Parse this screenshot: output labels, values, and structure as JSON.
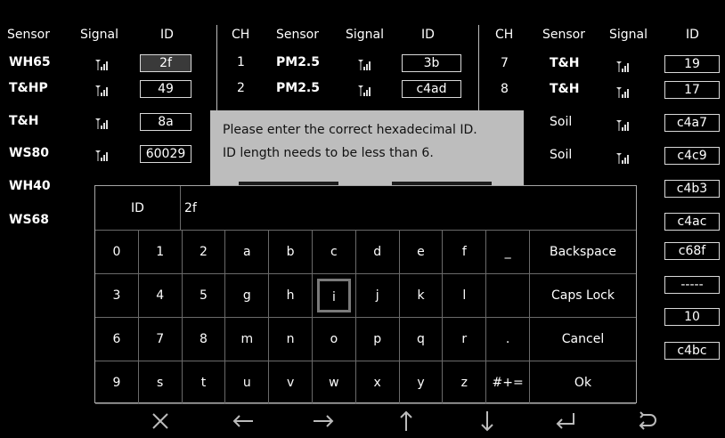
{
  "headers": {
    "col1": {
      "sensor": "Sensor",
      "signal": "Signal",
      "id": "ID"
    },
    "col2": {
      "ch": "CH",
      "sensor": "Sensor",
      "signal": "Signal",
      "id": "ID"
    },
    "col3": {
      "ch": "CH",
      "sensor": "Sensor",
      "signal": "Signal",
      "id": "ID"
    }
  },
  "table1": [
    {
      "sensor": "WH65",
      "id": "2f",
      "selected": true
    },
    {
      "sensor": "T&HP",
      "id": "49"
    },
    {
      "sensor": "T&H",
      "id": "8a"
    },
    {
      "sensor": "WS80",
      "id": "60029"
    },
    {
      "sensor": "WH40",
      "id": ""
    },
    {
      "sensor": "WS68",
      "id": ""
    }
  ],
  "table2": [
    {
      "ch": "1",
      "sensor": "PM2.5",
      "id": "3b"
    },
    {
      "ch": "2",
      "sensor": "PM2.5",
      "id": "c4ad"
    }
  ],
  "table3": [
    {
      "ch": "7",
      "sensor": "T&H",
      "id": "19"
    },
    {
      "ch": "8",
      "sensor": "T&H",
      "id": "17"
    },
    {
      "ch": "",
      "sensor": "Soil",
      "id": "c4a7"
    },
    {
      "ch": "",
      "sensor": "Soil",
      "id": "c4c9"
    },
    {
      "ch": "",
      "sensor": "",
      "id": "c4b3"
    },
    {
      "ch": "",
      "sensor": "",
      "id": "c4ac"
    },
    {
      "ch": "",
      "sensor": "",
      "id": "c68f"
    },
    {
      "ch": "",
      "sensor": "",
      "id": "-----"
    },
    {
      "ch": "",
      "sensor": "",
      "id": "10"
    },
    {
      "ch": "",
      "sensor": "",
      "id": "c4bc"
    }
  ],
  "dialog": {
    "line1": "Please enter the correct hexadecimal ID.",
    "line2": "ID length needs to be less than 6."
  },
  "keyboard": {
    "id_label": "ID",
    "input_value": "2f",
    "rows": [
      [
        "0",
        "1",
        "2",
        "a",
        "b",
        "c",
        "d",
        "e",
        "f",
        "_"
      ],
      [
        "3",
        "4",
        "5",
        "g",
        "h",
        "i",
        "j",
        "k",
        "l",
        ""
      ],
      [
        "6",
        "7",
        "8",
        "m",
        "n",
        "o",
        "p",
        "q",
        "r",
        "."
      ],
      [
        "9",
        "s",
        "t",
        "u",
        "v",
        "w",
        "x",
        "y",
        "z",
        "#+="
      ]
    ],
    "actions": [
      "Backspace",
      "Caps Lock",
      "Cancel",
      "Ok"
    ],
    "focused_key": "i"
  },
  "nav_icons": [
    "close-icon",
    "arrow-left-icon",
    "arrow-right-icon",
    "arrow-up-icon",
    "arrow-down-icon",
    "enter-icon",
    "return-icon"
  ],
  "colors": {
    "background": "#000000",
    "dialog": "#bdbdbd",
    "border": "#d9d9d9"
  }
}
